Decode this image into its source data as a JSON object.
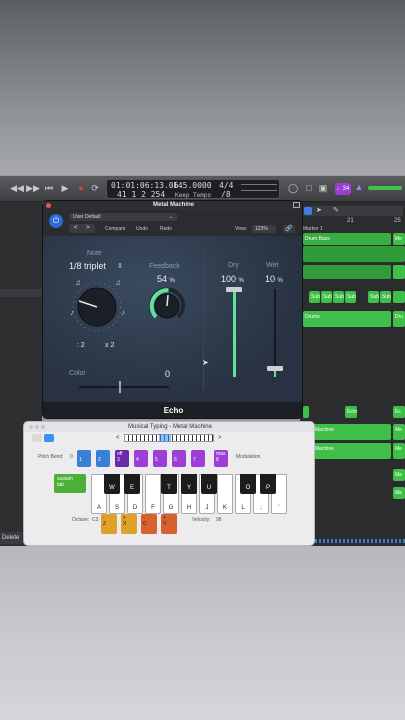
{
  "transport": {
    "position": "01:01:06:13.06",
    "bars": "41  1  2  254",
    "tempo": "145.0000",
    "tempo_mode": "Keep Tempo",
    "signature": "4/4",
    "division": "/8",
    "counter_badge": "♩34"
  },
  "plugin": {
    "title": "Metal Machine",
    "preset": "User Default",
    "compare": "Compare",
    "undo": "Undo",
    "redo": "Redo",
    "view_label": "View:",
    "view_zoom": "123%",
    "note_label": "Note",
    "note_value": "1/8 triplet",
    "div2": ": 2",
    "mul2": "x 2",
    "feedback_label": "Feedback",
    "feedback_value": "54",
    "feedback_unit": "%",
    "dry_label": "Dry",
    "dry_value": "100",
    "dry_unit": "%",
    "wet_label": "Wet",
    "wet_value": "10",
    "wet_unit": "%",
    "color_label": "Color",
    "color_value": "0",
    "effect_name": "Echo",
    "accent": "#5fe39a"
  },
  "arrange": {
    "ruler_number_1": "21",
    "ruler_number_2": "25",
    "marker": "Marker 1",
    "track1_region": "Drum Bass",
    "sub_regions": [
      "Sub",
      "Sub",
      "Sub",
      "Sub",
      "Sub",
      "Sub"
    ],
    "region_a": "Drums",
    "region_b": "Echo",
    "region_c": "Machine",
    "region_d": "Machine",
    "region_right_1": "Me",
    "region_right_2": "Dru",
    "region_right_3": "Ec",
    "region_right_4": "Me",
    "region_right_5": "Me",
    "region_right_6": "Ma",
    "region_right_7": "Ma"
  },
  "musical_typing": {
    "title": "Musical Typing - Metal Machine",
    "pitch_bend_label": "Pitch Bend:",
    "pitch_bend_value": "0",
    "modulation_label": "Modulation",
    "pitch_keys": [
      "1",
      "2",
      "3",
      "4",
      "5",
      "6",
      "7",
      "8"
    ],
    "pitch_key_labels": [
      "",
      "",
      "off",
      "",
      "",
      "",
      "",
      "max"
    ],
    "sustain_label": "sustain",
    "tab_label": "tab",
    "black_keys": [
      "W",
      "E",
      "T",
      "Y",
      "U",
      "O",
      "P"
    ],
    "white_keys": [
      "A",
      "S",
      "D",
      "F",
      "G",
      "H",
      "J",
      "K",
      "L",
      ";",
      "'"
    ],
    "octave_label": "Octave:",
    "octave_value": "C3",
    "octave_keys": [
      "Z",
      "X",
      "C",
      "V"
    ],
    "octave_symbols": [
      "-",
      "+",
      "-",
      "+"
    ],
    "velocity_label": "Velocity:",
    "velocity_value": "98"
  },
  "footer": {
    "delete_label": "Delete"
  }
}
